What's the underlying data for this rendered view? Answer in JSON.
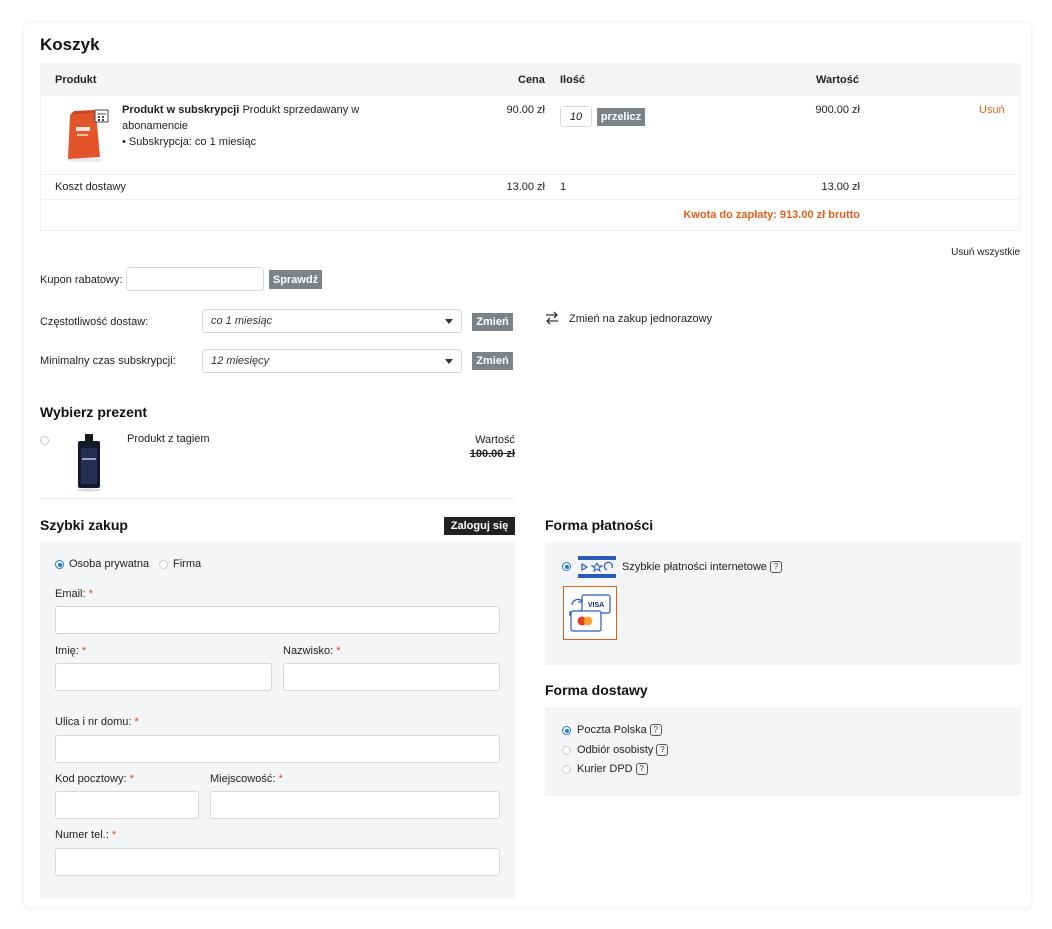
{
  "cart": {
    "title": "Koszyk",
    "headers": {
      "product": "Produkt",
      "price": "Cena",
      "qty": "Ilość",
      "value": "Wartość"
    },
    "item": {
      "name_bold": "Produkt w subskrypcji",
      "name_rest": "Produkt sprzedawany w",
      "name_line2": "abonamencie",
      "subscription": "• Subskrypcja: co 1 miesiąc",
      "price": "90.00 zł",
      "qty": "10",
      "recalc_label": "przelicz",
      "value": "900.00 zł",
      "remove_label": "Usuń"
    },
    "shipping": {
      "label": "Koszt dostawy",
      "price": "13.00 zł",
      "qty": "1",
      "value": "13.00 zł"
    },
    "total": "Kwota do zapłaty: 913.00 zł brutto",
    "remove_all": "Usuń wszystkie"
  },
  "coupon": {
    "label": "Kupon rabatowy:",
    "value": "",
    "check_label": "Sprawdź"
  },
  "subscription": {
    "frequency_label": "Częstotliwość dostaw:",
    "frequency_value": "co 1 miesiąc",
    "min_label": "Minimalny czas subskrypcji:",
    "min_value": "12 miesięcy",
    "change_label": "Zmień",
    "switch_label": "Zmień na zakup jednorazowy"
  },
  "gift": {
    "title": "Wybierz prezent",
    "product": "Produkt z tagiem",
    "value_label": "Wartość",
    "value": "100.00 zł"
  },
  "quick": {
    "title": "Szybki zakup",
    "login_label": "Zaloguj się",
    "private_label": "Osoba prywatna",
    "company_label": "Firma",
    "email_label": "Email:",
    "first_name_label": "Imię:",
    "last_name_label": "Nazwisko:",
    "street_label": "Ulica i nr domu:",
    "zip_label": "Kod pocztowy:",
    "city_label": "Miejscowość:",
    "phone_label": "Numer tel.:",
    "required_mark": "*"
  },
  "payment": {
    "title": "Forma płatności",
    "method": "Szybkie płatności internetowe",
    "help": "?",
    "card_label": "VISA"
  },
  "delivery": {
    "title": "Forma dostawy",
    "options": [
      "Poczta Polska",
      "Odbiór osobisty",
      "Kurier DPD"
    ],
    "help": "?"
  },
  "colors": {
    "accent": "#e0611e",
    "button_gray": "#7d8286",
    "panel_bg": "#f3f5f6",
    "radio_blue": "#1f7ad6"
  }
}
